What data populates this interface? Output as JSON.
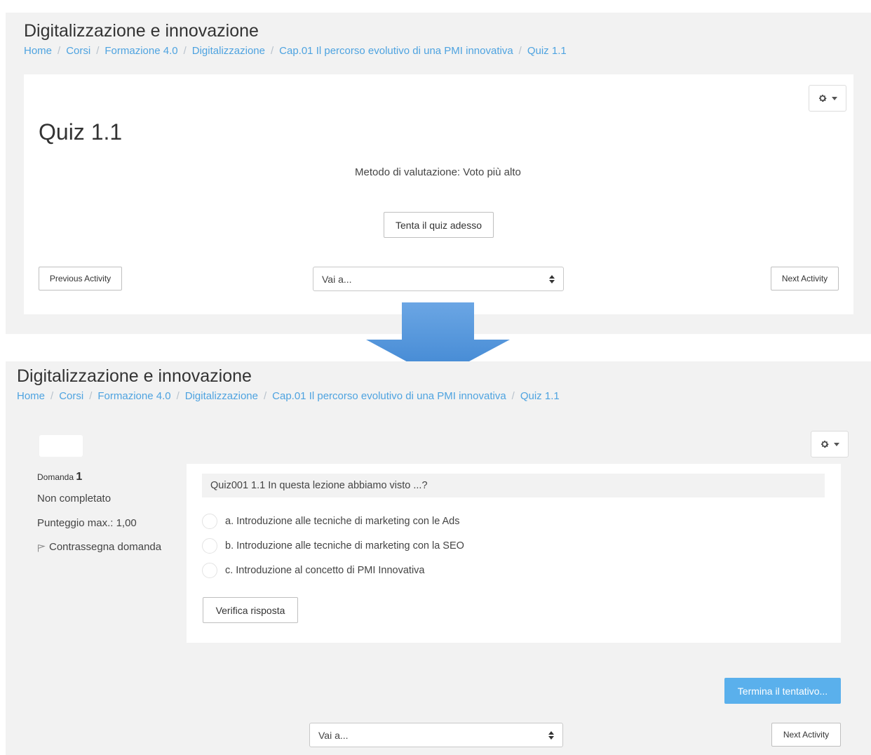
{
  "top": {
    "course_title": "Digitalizzazione e innovazione",
    "breadcrumb": [
      "Home",
      "Corsi",
      "Formazione 4.0",
      "Digitalizzazione",
      "Cap.01 Il percorso evolutivo di una PMI innovativa",
      "Quiz 1.1"
    ],
    "breadcrumb_separator": "/",
    "quiz_heading": "Quiz 1.1",
    "grading_method": "Metodo di valutazione: Voto più alto",
    "attempt_button": "Tenta il quiz adesso",
    "previous_activity": "Previous Activity",
    "jump_to": "Vai a...",
    "next_activity": "Next Activity",
    "gear_icon": "gear-icon"
  },
  "bottom": {
    "course_title": "Digitalizzazione e innovazione",
    "breadcrumb": [
      "Home",
      "Corsi",
      "Formazione 4.0",
      "Digitalizzazione",
      "Cap.01 Il percorso evolutivo di una PMI innovativa",
      "Quiz 1.1"
    ],
    "breadcrumb_separator": "/",
    "question_label": "Domanda",
    "question_number": "1",
    "status": "Non completato",
    "max_score": "Punteggio max.: 1,00",
    "flag_question": "Contrassegna domanda",
    "question_text": "Quiz001 1.1 In questa lezione abbiamo visto ...?",
    "answers": [
      {
        "letter": "a.",
        "text": "Introduzione alle tecniche di marketing con le Ads"
      },
      {
        "letter": "b.",
        "text": "Introduzione alle tecniche di marketing con la SEO"
      },
      {
        "letter": "c.",
        "text": "Introduzione al concetto di PMI Innovativa"
      }
    ],
    "check_button": "Verifica risposta",
    "finish_attempt": "Termina il tentativo...",
    "jump_to": "Vai a...",
    "next_activity": "Next Activity"
  },
  "colors": {
    "link": "#4ea3e0",
    "panel_background": "#f2f2f2",
    "primary_button": "#5ab0ec",
    "arrow": "#4a8fd6"
  }
}
